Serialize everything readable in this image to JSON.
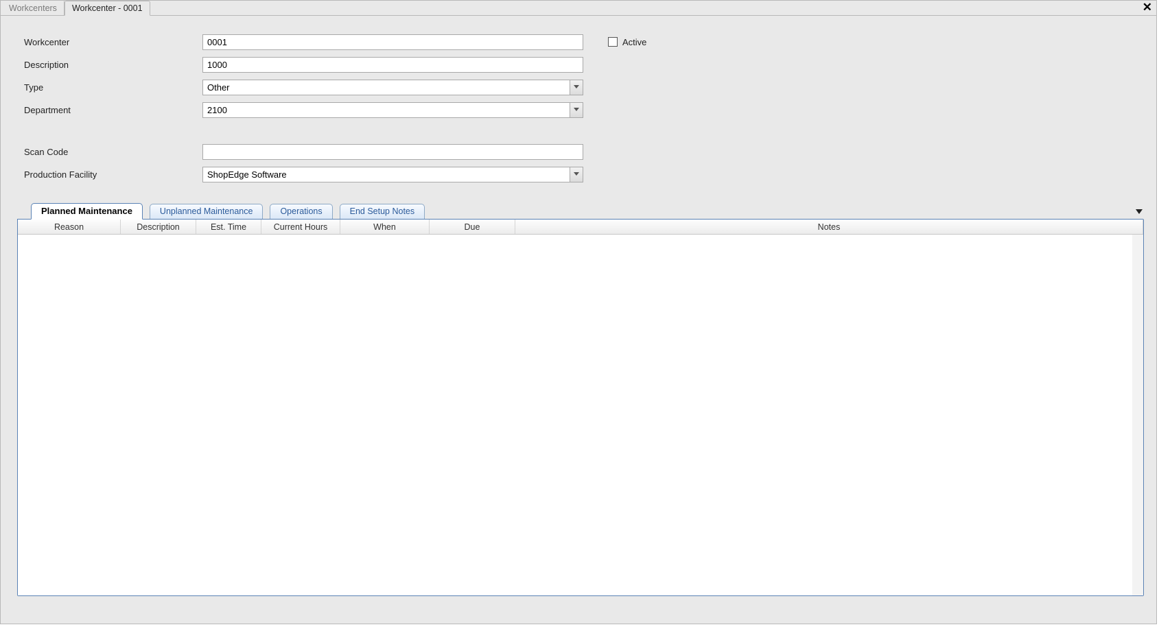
{
  "outerTabs": {
    "tab0": "Workcenters",
    "tab1": "Workcenter - 0001"
  },
  "form": {
    "labels": {
      "workcenter": "Workcenter",
      "description": "Description",
      "type": "Type",
      "department": "Department",
      "scanCode": "Scan Code",
      "productionFacility": "Production Facility",
      "active": "Active"
    },
    "values": {
      "workcenter": "0001",
      "description": "1000",
      "type": "Other",
      "department": "2100",
      "scanCode": "",
      "productionFacility": "ShopEdge Software"
    }
  },
  "innerTabs": {
    "t0": "Planned Maintenance",
    "t1": "Unplanned Maintenance",
    "t2": "Operations",
    "t3": "End Setup Notes"
  },
  "gridColumns": {
    "c0": "Reason",
    "c1": "Description",
    "c2": "Est. Time",
    "c3": "Current Hours",
    "c4": "When",
    "c5": "Due",
    "c6": "Notes"
  }
}
